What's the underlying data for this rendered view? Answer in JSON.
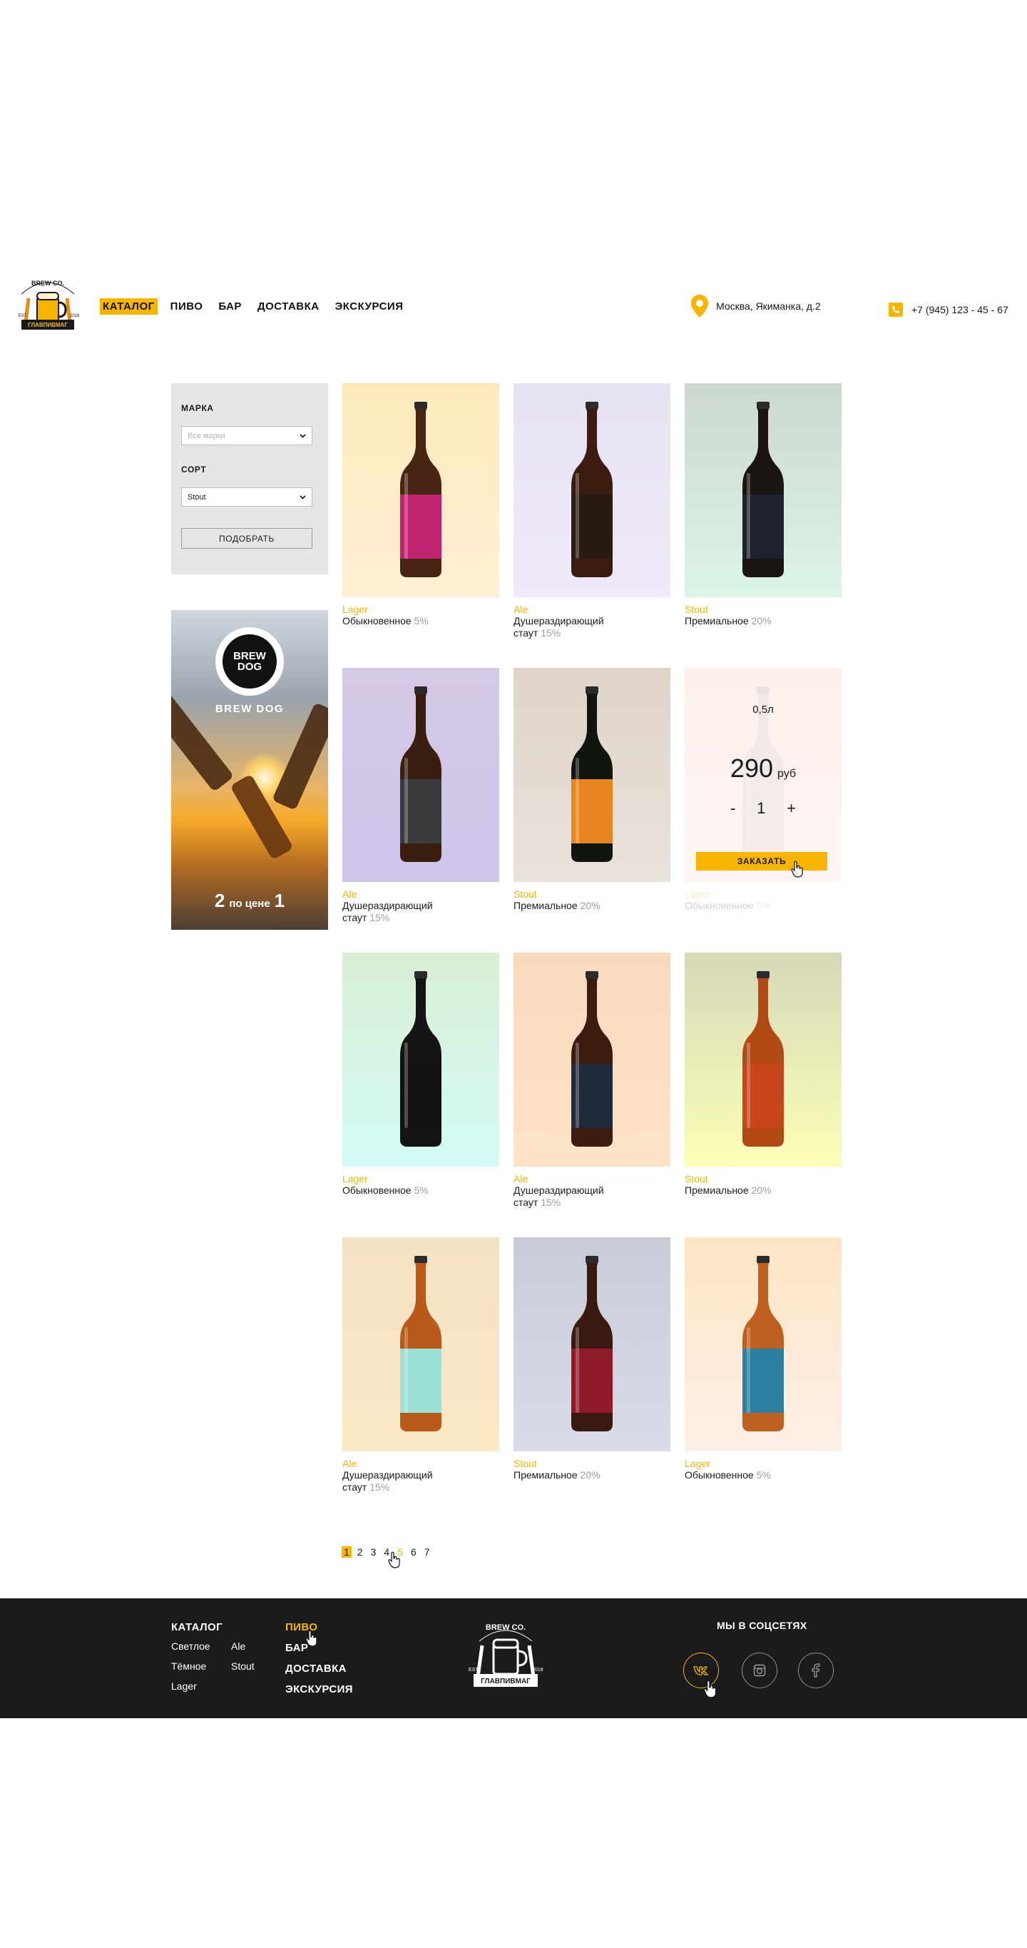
{
  "header": {
    "logo_text_top": "BREW CO.",
    "logo_text_banner": "ГЛАВПИВМАГ",
    "logo_side_left": "EST",
    "logo_side_right": "2018",
    "nav": [
      {
        "label": "КАТАЛОГ",
        "active": true
      },
      {
        "label": "ПИВО",
        "active": false
      },
      {
        "label": "БАР",
        "active": false
      },
      {
        "label": "ДОСТАВКА",
        "active": false
      },
      {
        "label": "ЭКСКУРСИЯ",
        "active": false
      }
    ],
    "address": "Москва, Якиманка, д.2",
    "phone": "+7 (945) 123 - 45 - 67"
  },
  "filter": {
    "brand_label": "МАРКА",
    "brand_placeholder": "Все марки",
    "sort_label": "СОРТ",
    "sort_value": "Stout",
    "submit_label": "ПОДОБРАТЬ"
  },
  "promo": {
    "badge": "BREW DOG",
    "brand": "BREW DOG",
    "num_a": "2",
    "text": "по цене",
    "num_b": "1"
  },
  "products": [
    {
      "cat": "Lager",
      "name1": "Обыкновенное",
      "name2": "",
      "pct": "5%",
      "bg_top": "#fde9bb",
      "bg_bottom": "#fff0d4",
      "label": "#c0246e",
      "glass": "#4a2412"
    },
    {
      "cat": "Ale",
      "name1": "Душераздирающий",
      "name2": "стаут",
      "pct": "15%",
      "bg_top": "#e6e1f3",
      "bg_bottom": "#efe9fb",
      "label": "#2a1a14",
      "glass": "#3a1c10"
    },
    {
      "cat": "Stout",
      "name1": "Премиальное",
      "name2": "",
      "pct": "20%",
      "bg_top": "#ccd8cf",
      "bg_bottom": "#dcf5e6",
      "label": "#1e2230",
      "glass": "#1a1412"
    },
    {
      "cat": "Ale",
      "name1": "Душераздирающий",
      "name2": "стаут",
      "pct": "15%",
      "bg_top": "#d4c9e6",
      "bg_bottom": "#cfc4e9",
      "label": "#3b3b3b",
      "glass": "#3a1e10"
    },
    {
      "cat": "Stout",
      "name1": "Премиальное",
      "name2": "",
      "pct": "20%",
      "bg_top": "#e0d4c8",
      "bg_bottom": "#e8e2dc",
      "label": "#e98520",
      "glass": "#10160e"
    },
    {
      "cat": "Lager",
      "name1": "Обыкновенное",
      "name2": "",
      "pct": "5%",
      "bg_top": "#fdf0ec",
      "bg_bottom": "#fef5f3",
      "label": "#dddddd",
      "glass": "#dddddd"
    },
    {
      "cat": "Lager",
      "name1": "Обыкновенное",
      "name2": "",
      "pct": "5%",
      "bg_top": "#d9efd4",
      "bg_bottom": "#d2fbf6",
      "label": "#111111",
      "glass": "#141414"
    },
    {
      "cat": "Ale",
      "name1": "Душераздирающий",
      "name2": "стаут",
      "pct": "15%",
      "bg_top": "#f7d9be",
      "bg_bottom": "#fde3c8",
      "label": "#1f2a3b",
      "glass": "#3a1c10"
    },
    {
      "cat": "Stout",
      "name1": "Премиальное",
      "name2": "",
      "pct": "20%",
      "bg_top": "#d6d8b8",
      "bg_bottom": "#fbffb6",
      "label": "#c9451b",
      "glass": "#b24a16"
    },
    {
      "cat": "Ale",
      "name1": "Душераздирающий",
      "name2": "стаут",
      "pct": "15%",
      "bg_top": "#f2e2c4",
      "bg_bottom": "#fde8c5",
      "label": "#9ee0d8",
      "glass": "#b95a1a"
    },
    {
      "cat": "Stout",
      "name1": "Премиальное",
      "name2": "",
      "pct": "20%",
      "bg_top": "#c9cbd8",
      "bg_bottom": "#d8dce9",
      "label": "#8f1a2a",
      "glass": "#3a1a10"
    },
    {
      "cat": "Lager",
      "name1": "Обыкновенное",
      "name2": "",
      "pct": "5%",
      "bg_top": "#fde4c4",
      "bg_bottom": "#fff0e6",
      "label": "#2d7fa0",
      "glass": "#c06020"
    }
  ],
  "hover_card": {
    "volume": "0,5л",
    "price": "290",
    "currency": "руб",
    "minus": "-",
    "qty": "1",
    "plus": "+",
    "order": "ЗАКАЗАТЬ"
  },
  "pagination": {
    "pages": [
      "1",
      "2",
      "3",
      "4",
      "5",
      "6",
      "7"
    ],
    "active": "1",
    "hover": "5"
  },
  "footer": {
    "col1_title": "КАТАЛОГ",
    "col1_items": [
      [
        "Светлое",
        "Ale"
      ],
      [
        "Тёмное",
        "Stout"
      ],
      [
        "Lager",
        ""
      ]
    ],
    "col2_items": [
      "ПИВО",
      "БАР",
      "ДОСТАВКА",
      "ЭКСКУРСИЯ"
    ],
    "social_title": "МЫ В СОЦСЕТЯХ",
    "logo_text_top": "BREW CO.",
    "logo_text_banner": "ГЛАВПИВМАГ",
    "logo_side_left": "EST",
    "logo_side_right": "2018"
  },
  "colors": {
    "accent": "#f7b500",
    "footer_bg": "#1b1b1b",
    "filter_bg": "#e6e6e6"
  }
}
